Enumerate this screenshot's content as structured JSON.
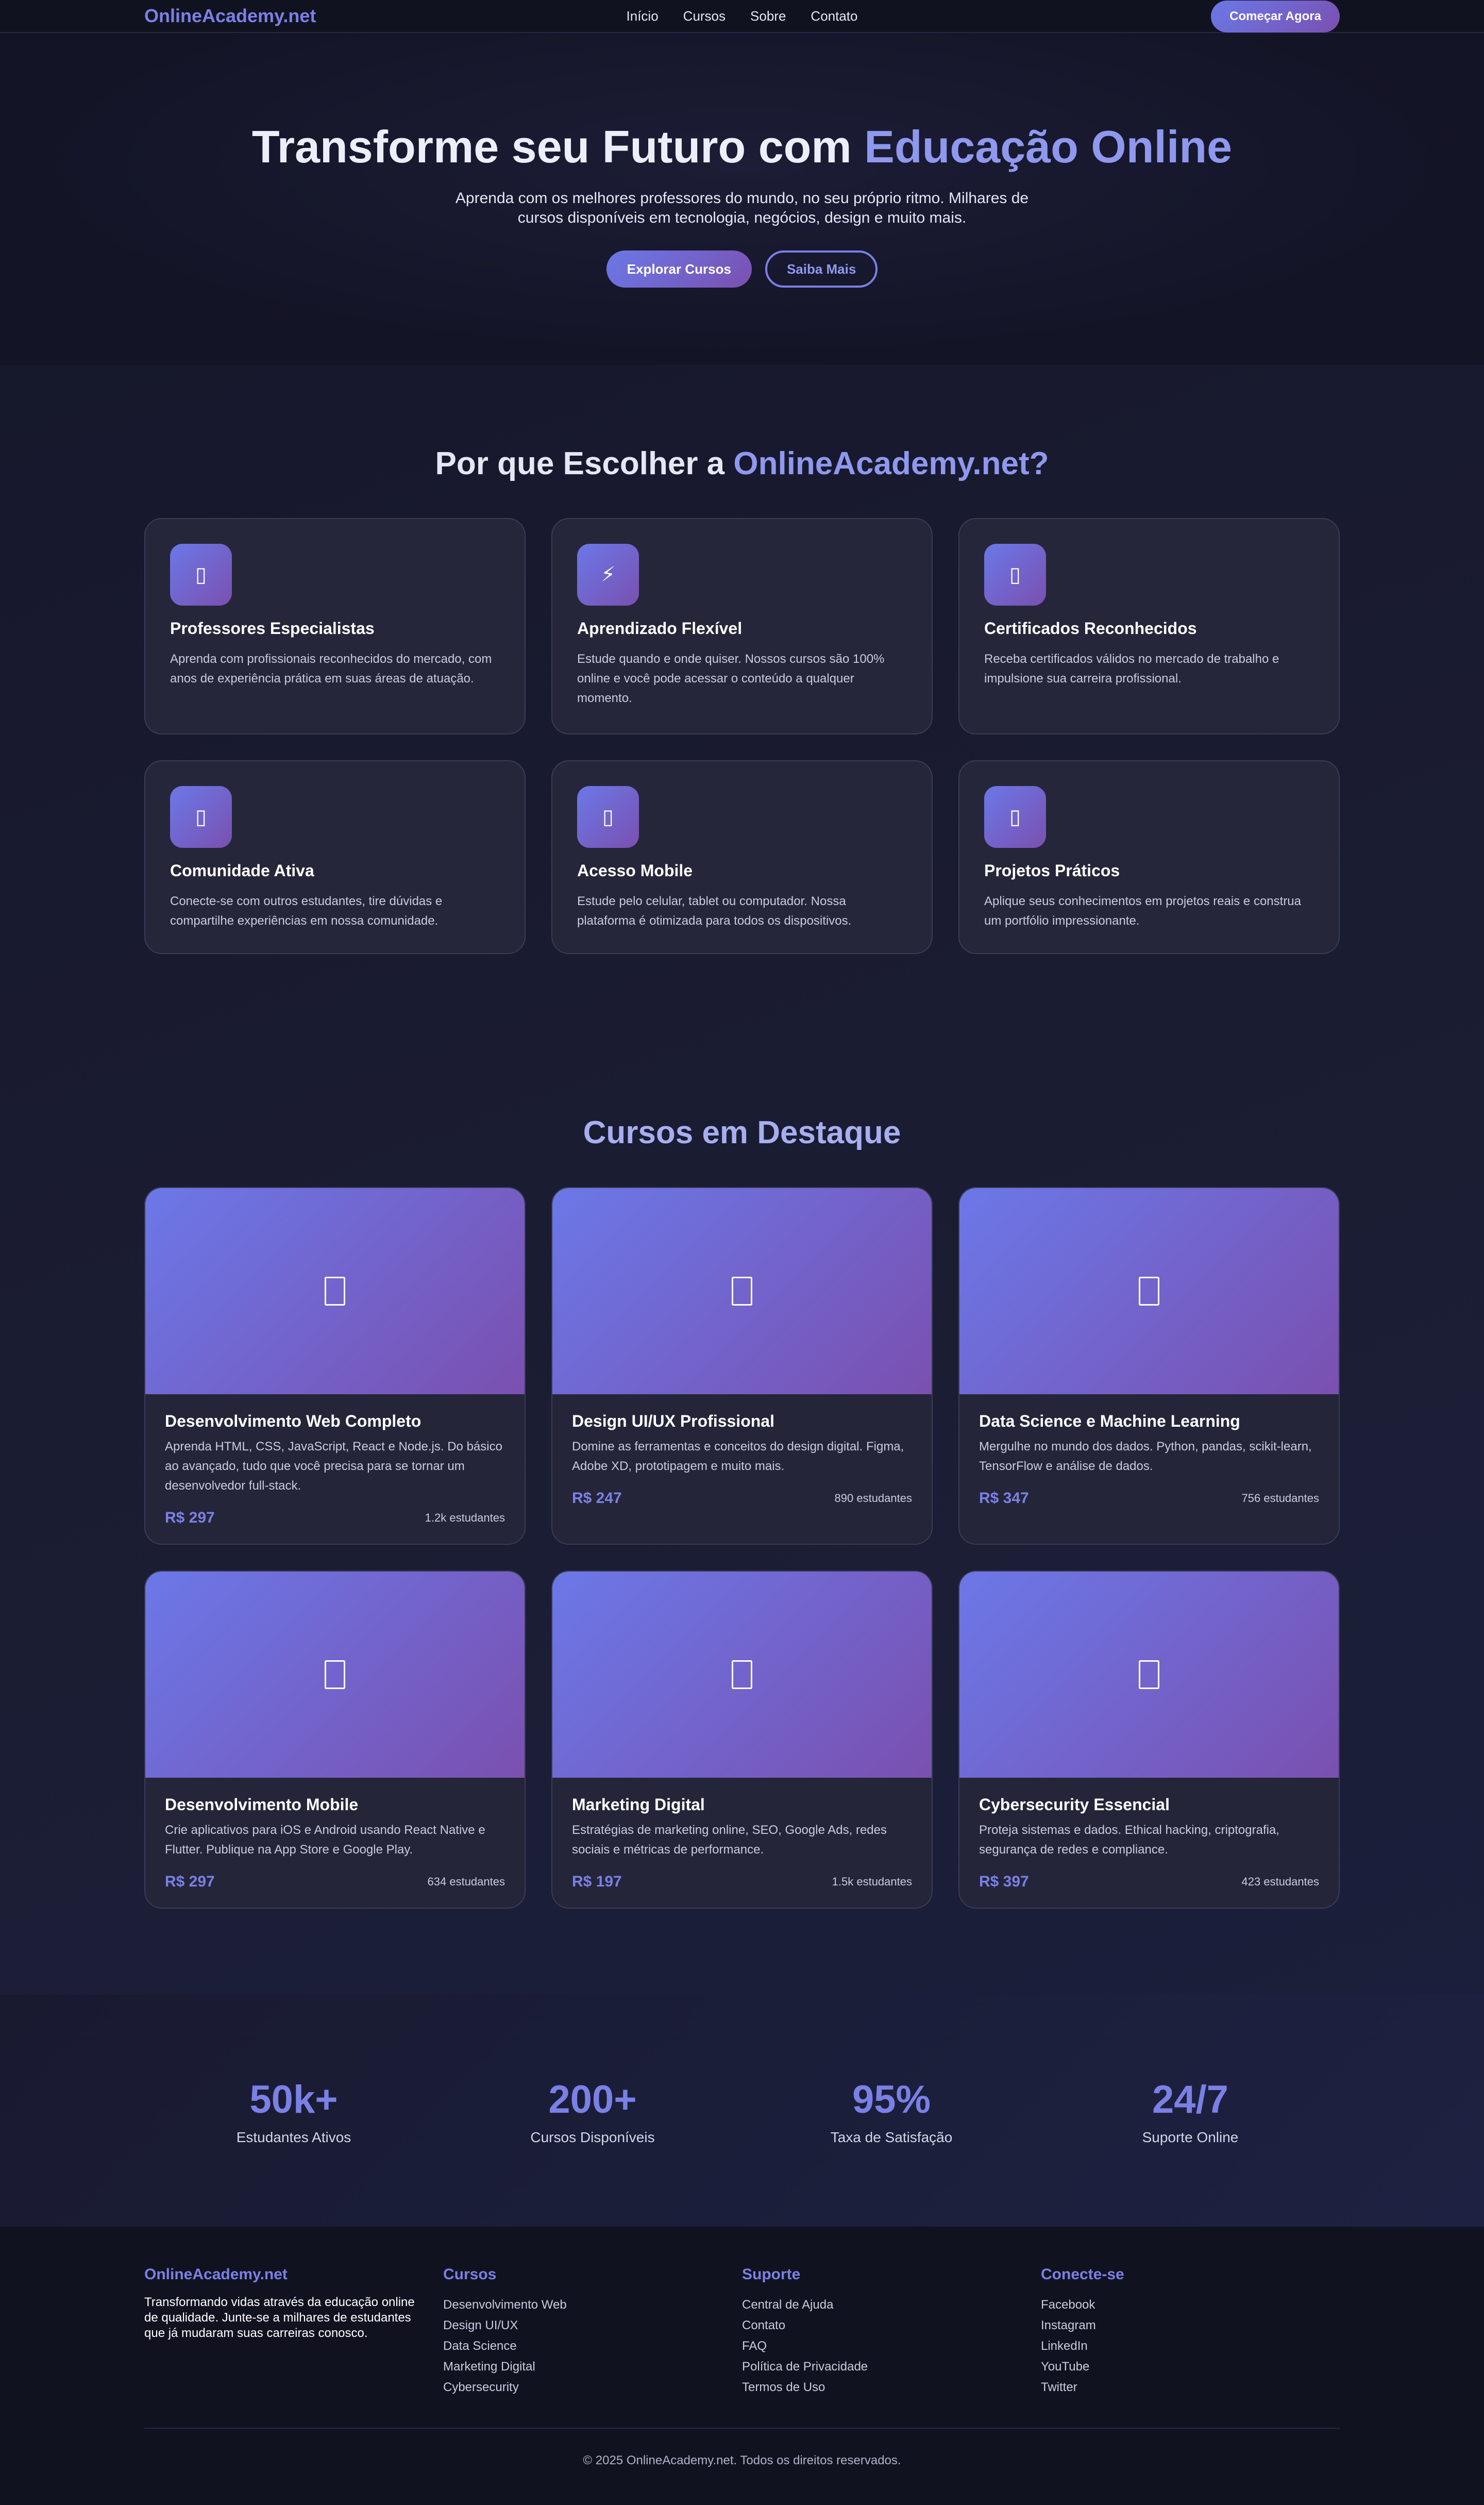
{
  "nav": {
    "logo": "OnlineAcademy.net",
    "links": [
      "Início",
      "Cursos",
      "Sobre",
      "Contato"
    ],
    "cta": "Começar Agora"
  },
  "hero": {
    "title_main": "Transforme seu Futuro com ",
    "title_accent": "Educação Online",
    "subtitle": "Aprenda com os melhores professores do mundo, no seu próprio ritmo. Milhares de cursos disponíveis em tecnologia, negócios, design e muito mais.",
    "btn_primary": "Explorar Cursos",
    "btn_secondary": "Saiba Mais"
  },
  "features": {
    "title_main": "Por que Escolher a ",
    "title_accent": "OnlineAcademy.net?",
    "items": [
      {
        "icon": "teacher-icon",
        "glyph": "▯",
        "title": "Professores Especialistas",
        "desc": "Aprenda com profissionais reconhecidos do mercado, com anos de experiência prática em suas áreas de atuação."
      },
      {
        "icon": "lightning-icon",
        "glyph": "⚡",
        "title": "Aprendizado Flexível",
        "desc": "Estude quando e onde quiser. Nossos cursos são 100% online e você pode acessar o conteúdo a qualquer momento."
      },
      {
        "icon": "certificate-icon",
        "glyph": "▯",
        "title": "Certificados Reconhecidos",
        "desc": "Receba certificados válidos no mercado de trabalho e impulsione sua carreira profissional."
      },
      {
        "icon": "community-icon",
        "glyph": "▯",
        "title": "Comunidade Ativa",
        "desc": "Conecte-se com outros estudantes, tire dúvidas e compartilhe experiências em nossa comunidade."
      },
      {
        "icon": "mobile-icon",
        "glyph": "▯",
        "title": "Acesso Mobile",
        "desc": "Estude pelo celular, tablet ou computador. Nossa plataforma é otimizada para todos os dispositivos."
      },
      {
        "icon": "project-icon",
        "glyph": "▯",
        "title": "Projetos Práticos",
        "desc": "Aplique seus conhecimentos em projetos reais e construa um portfólio impressionante."
      }
    ]
  },
  "courses": {
    "title": "Cursos em Destaque",
    "items": [
      {
        "title": "Desenvolvimento Web Completo",
        "desc": "Aprenda HTML, CSS, JavaScript, React e Node.js. Do básico ao avançado, tudo que você precisa para se tornar um desenvolvedor full-stack.",
        "price": "R$ 297",
        "students": "1.2k estudantes"
      },
      {
        "title": "Design UI/UX Profissional",
        "desc": "Domine as ferramentas e conceitos do design digital. Figma, Adobe XD, prototipagem e muito mais.",
        "price": "R$ 247",
        "students": "890 estudantes"
      },
      {
        "title": "Data Science e Machine Learning",
        "desc": "Mergulhe no mundo dos dados. Python, pandas, scikit-learn, TensorFlow e análise de dados.",
        "price": "R$ 347",
        "students": "756 estudantes"
      },
      {
        "title": "Desenvolvimento Mobile",
        "desc": "Crie aplicativos para iOS e Android usando React Native e Flutter. Publique na App Store e Google Play.",
        "price": "R$ 297",
        "students": "634 estudantes"
      },
      {
        "title": "Marketing Digital",
        "desc": "Estratégias de marketing online, SEO, Google Ads, redes sociais e métricas de performance.",
        "price": "R$ 197",
        "students": "1.5k estudantes"
      },
      {
        "title": "Cybersecurity Essencial",
        "desc": "Proteja sistemas e dados. Ethical hacking, criptografia, segurança de redes e compliance.",
        "price": "R$ 397",
        "students": "423 estudantes"
      }
    ]
  },
  "stats": [
    {
      "value": "50k+",
      "label": "Estudantes Ativos"
    },
    {
      "value": "200+",
      "label": "Cursos Disponíveis"
    },
    {
      "value": "95%",
      "label": "Taxa de Satisfação"
    },
    {
      "value": "24/7",
      "label": "Suporte Online"
    }
  ],
  "footer": {
    "brand": "OnlineAcademy.net",
    "about": "Transformando vidas através da educação online de qualidade. Junte-se a milhares de estudantes que já mudaram suas carreiras conosco.",
    "columns": [
      {
        "title": "Cursos",
        "links": [
          "Desenvolvimento Web",
          "Design UI/UX",
          "Data Science",
          "Marketing Digital",
          "Cybersecurity"
        ]
      },
      {
        "title": "Suporte",
        "links": [
          "Central de Ajuda",
          "Contato",
          "FAQ",
          "Política de Privacidade",
          "Termos de Uso"
        ]
      },
      {
        "title": "Conecte-se",
        "links": [
          "Facebook",
          "Instagram",
          "LinkedIn",
          "YouTube",
          "Twitter"
        ]
      }
    ],
    "copyright": "© 2025 OnlineAcademy.net. Todos os direitos reservados."
  },
  "colors": {
    "accent": "#7b80e6",
    "gradient_start": "#6b78e8",
    "gradient_end": "#7a50b0",
    "background": "#15162a",
    "card": "#252639"
  }
}
